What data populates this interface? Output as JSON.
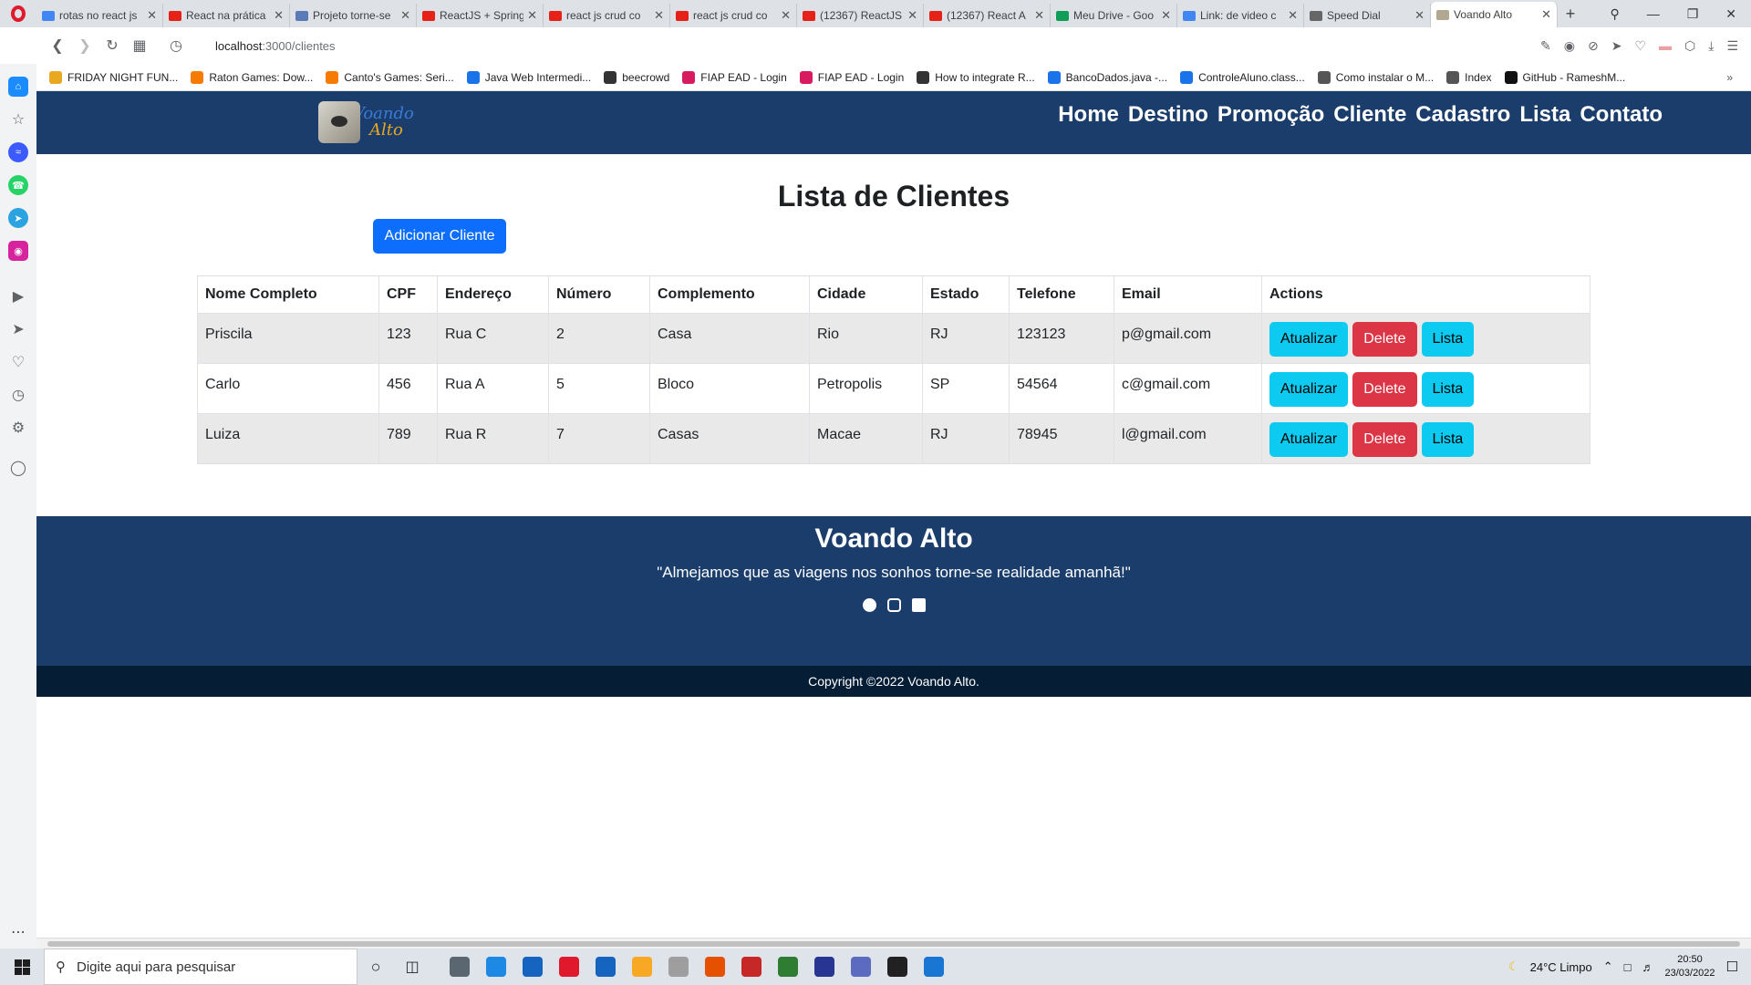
{
  "browser": {
    "tabs": [
      {
        "label": "rotas no react js",
        "color": "#4285f4"
      },
      {
        "label": "React na prática",
        "color": "#e62117"
      },
      {
        "label": "Projeto torne-se",
        "color": "#5a7bb5"
      },
      {
        "label": "ReactJS + Spring",
        "color": "#e62117"
      },
      {
        "label": "react js crud co",
        "color": "#e62117"
      },
      {
        "label": "react js crud co",
        "color": "#e62117"
      },
      {
        "label": "(12367) ReactJS",
        "color": "#e62117"
      },
      {
        "label": "(12367) React A",
        "color": "#e62117"
      },
      {
        "label": "Meu Drive - Goo",
        "color": "#0f9d58"
      },
      {
        "label": "Link: de video c",
        "color": "#4285f4"
      },
      {
        "label": "Speed Dial",
        "color": "#666666"
      },
      {
        "label": "Voando Alto",
        "color": "#b0a890",
        "active": true
      }
    ],
    "url_host": "localhost",
    "url_path": ":3000/clientes",
    "bookmarks": [
      {
        "label": "FRIDAY NIGHT FUN...",
        "color": "#e8a820"
      },
      {
        "label": "Raton Games: Dow...",
        "color": "#f57c00"
      },
      {
        "label": "Canto's Games: Seri...",
        "color": "#f57c00"
      },
      {
        "label": "Java Web Intermedi...",
        "color": "#1a73e8"
      },
      {
        "label": "beecrowd",
        "color": "#333333"
      },
      {
        "label": "FIAP EAD - Login",
        "color": "#d81b60"
      },
      {
        "label": "FIAP EAD - Login",
        "color": "#d81b60"
      },
      {
        "label": "How to integrate R...",
        "color": "#333333"
      },
      {
        "label": "BancoDados.java -...",
        "color": "#1a73e8"
      },
      {
        "label": "ControleAluno.class...",
        "color": "#1a73e8"
      },
      {
        "label": "Como instalar o M...",
        "color": "#555555"
      },
      {
        "label": "Index",
        "color": "#555555"
      },
      {
        "label": "GitHub - RameshM...",
        "color": "#111111"
      }
    ]
  },
  "site": {
    "logo_line1": "Voando",
    "logo_line2": "Alto",
    "nav": [
      "Home",
      "Destino",
      "Promoção",
      "Cliente",
      "Cadastro",
      "Lista",
      "Contato"
    ],
    "title": "Lista de Clientes",
    "add_button": "Adicionar Cliente",
    "table": {
      "headers": [
        "Nome Completo",
        "CPF",
        "Endereço",
        "Número",
        "Complemento",
        "Cidade",
        "Estado",
        "Telefone",
        "Email",
        "Actions"
      ],
      "rows": [
        [
          "Priscila",
          "123",
          "Rua C",
          "2",
          "Casa",
          "Rio",
          "RJ",
          "123123",
          "p@gmail.com"
        ],
        [
          "Carlo",
          "456",
          "Rua A",
          "5",
          "Bloco",
          "Petropolis",
          "SP",
          "54564",
          "c@gmail.com"
        ],
        [
          "Luiza",
          "789",
          "Rua R",
          "7",
          "Casas",
          "Macae",
          "RJ",
          "78945",
          "l@gmail.com"
        ]
      ],
      "actions": {
        "update": "Atualizar",
        "delete": "Delete",
        "list": "Lista"
      }
    },
    "footer": {
      "title": "Voando Alto",
      "quote": "\"Almejamos que as viagens nos sonhos torne-se realidade amanhã!\"",
      "copyright": "Copyright ©2022 Voando Alto."
    }
  },
  "taskbar": {
    "search_placeholder": "Digite aqui para pesquisar",
    "weather": "24°C Limpo",
    "time": "20:50",
    "date": "23/03/2022",
    "apps": [
      "#5b6770",
      "#1e88e5",
      "#1565c0",
      "#e0192c",
      "#1565c0",
      "#f9a825",
      "#9e9e9e",
      "#e65100",
      "#c62828",
      "#2e7d32",
      "#283593",
      "#5c6bc0",
      "#212121",
      "#1976d2"
    ]
  }
}
